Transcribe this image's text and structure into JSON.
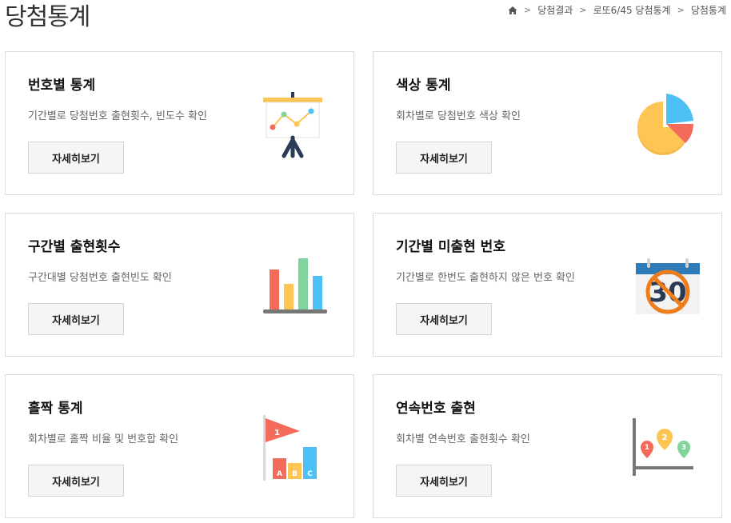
{
  "page": {
    "title": "당첨통계"
  },
  "breadcrumb": {
    "home_icon": "home-icon",
    "items": [
      "당첨결과",
      "로또6/45 당첨통계",
      "당첨통계"
    ]
  },
  "cards": [
    {
      "title": "번호별 통계",
      "desc": "기간별로 당첨번호 출현횟수, 빈도수 확인",
      "button": "자세히보기",
      "icon": "presentation-board-icon"
    },
    {
      "title": "색상 통계",
      "desc": "회차별로 당첨번호 색상 확인",
      "button": "자세히보기",
      "icon": "pie-chart-icon"
    },
    {
      "title": "구간별 출현횟수",
      "desc": "구간대별 당첨번호 출현빈도 확인",
      "button": "자세히보기",
      "icon": "bar-chart-icon"
    },
    {
      "title": "기간별 미출현 번호",
      "desc": "기간별로 한번도 출현하지 않은 번호 확인",
      "button": "자세히보기",
      "icon": "calendar-no-30-icon",
      "icon_text": "30"
    },
    {
      "title": "홀짝 통계",
      "desc": "회차별로 홀짝 비율 및 번호합 확인",
      "button": "자세히보기",
      "icon": "flag-abc-bars-icon",
      "icon_labels": [
        "1",
        "A",
        "B",
        "C"
      ]
    },
    {
      "title": "연속번호 출현",
      "desc": "회차별 연속번호 출현횟수 확인",
      "button": "자세히보기",
      "icon": "map-pins-chart-icon",
      "icon_labels": [
        "1",
        "2",
        "3"
      ]
    }
  ],
  "colors": {
    "red": "#f26b5b",
    "yellow": "#fdc654",
    "green": "#81d49b",
    "blue": "#4dc0f5",
    "orange": "#ef7d1a",
    "navy": "#2b3a55"
  }
}
